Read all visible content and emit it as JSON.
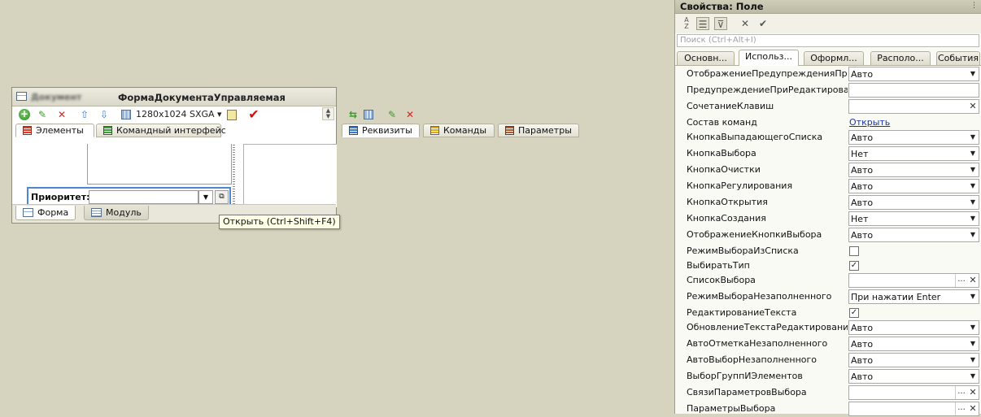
{
  "designer": {
    "title_blurred": "Документ",
    "title": "ФормаДокументаУправляемая",
    "resolution": "1280x1024 SXGA",
    "left_tabs": [
      {
        "label": "Элементы",
        "active": true
      },
      {
        "label": "Командный интерфейс",
        "active": false
      }
    ],
    "right_tabs": [
      {
        "label": "Реквизиты",
        "active": true
      },
      {
        "label": "Команды",
        "active": false
      },
      {
        "label": "Параметры",
        "active": false
      }
    ],
    "priority_label": "Приоритет:",
    "bottom_tabs": [
      {
        "label": "Форма",
        "active": true
      },
      {
        "label": "Модуль",
        "active": false
      }
    ],
    "tooltip": "Открыть (Ctrl+Shift+F4)"
  },
  "properties": {
    "title": "Свойства: Поле",
    "search_placeholder": "Поиск (Ctrl+Alt+I)",
    "tabs": [
      {
        "label": "Основн...",
        "active": false
      },
      {
        "label": "Использ...",
        "active": true
      },
      {
        "label": "Оформл...",
        "active": false
      },
      {
        "label": "Располо...",
        "active": false
      },
      {
        "label": "События",
        "active": false
      }
    ],
    "rows": [
      {
        "name": "ОтображениеПредупрежденияПриРедактировании",
        "kind": "combo",
        "value": "Авто"
      },
      {
        "name": "ПредупреждениеПриРедактировании",
        "kind": "text",
        "value": ""
      },
      {
        "name": "СочетаниеКлавиш",
        "kind": "clear",
        "value": ""
      },
      {
        "name": "Состав команд",
        "kind": "link",
        "value": "Открыть"
      },
      {
        "name": "КнопкаВыпадающегоСписка",
        "kind": "combo",
        "value": "Авто"
      },
      {
        "name": "КнопкаВыбора",
        "kind": "combo",
        "value": "Нет"
      },
      {
        "name": "КнопкаОчистки",
        "kind": "combo",
        "value": "Авто"
      },
      {
        "name": "КнопкаРегулирования",
        "kind": "combo",
        "value": "Авто"
      },
      {
        "name": "КнопкаОткрытия",
        "kind": "combo",
        "value": "Авто"
      },
      {
        "name": "КнопкаСоздания",
        "kind": "combo",
        "value": "Нет"
      },
      {
        "name": "ОтображениеКнопкиВыбора",
        "kind": "combo",
        "value": "Авто"
      },
      {
        "name": "РежимВыбораИзСписка",
        "kind": "check",
        "value": false
      },
      {
        "name": "ВыбиратьТип",
        "kind": "check",
        "value": true
      },
      {
        "name": "СписокВыбора",
        "kind": "select",
        "value": ""
      },
      {
        "name": "РежимВыбораНезаполненного",
        "kind": "combo",
        "value": "При нажатии Enter"
      },
      {
        "name": "РедактированиеТекста",
        "kind": "check",
        "value": true
      },
      {
        "name": "ОбновлениеТекстаРедактирования",
        "kind": "combo",
        "value": "Авто"
      },
      {
        "name": "АвтоОтметкаНезаполненного",
        "kind": "combo",
        "value": "Авто"
      },
      {
        "name": "АвтоВыборНезаполненного",
        "kind": "combo",
        "value": "Авто"
      },
      {
        "name": "ВыборГруппИЭлементов",
        "kind": "combo",
        "value": "Авто"
      },
      {
        "name": "СвязиПараметровВыбора",
        "kind": "select",
        "value": ""
      },
      {
        "name": "ПараметрыВыбора",
        "kind": "select",
        "value": ""
      }
    ]
  }
}
